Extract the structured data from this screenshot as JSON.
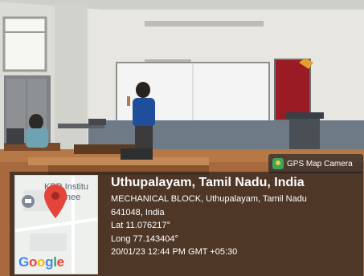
{
  "camera_badge": {
    "label": "GPS Map Camera",
    "icon": "gps-map-camera-icon"
  },
  "map": {
    "text": "KPR Institu\n  o  ginee",
    "logo": "Google",
    "logo_colors": [
      "#4285F4",
      "#EA4335",
      "#FBBC05",
      "#4285F4",
      "#34A853",
      "#EA4335"
    ]
  },
  "location": {
    "title": "Uthupalayam, Tamil Nadu, India",
    "address_line1": "MECHANICAL BLOCK, Uthupalayam, Tamil Nadu",
    "address_line2": "641048, India",
    "lat": "Lat 11.076217°",
    "long": "Long 77.143404°",
    "datetime": "20/01/23 12:44 PM GMT +05:30"
  },
  "colors": {
    "pin": "#e4453a",
    "board_red": "#9a1b24",
    "wall": "#e9e9e4"
  }
}
